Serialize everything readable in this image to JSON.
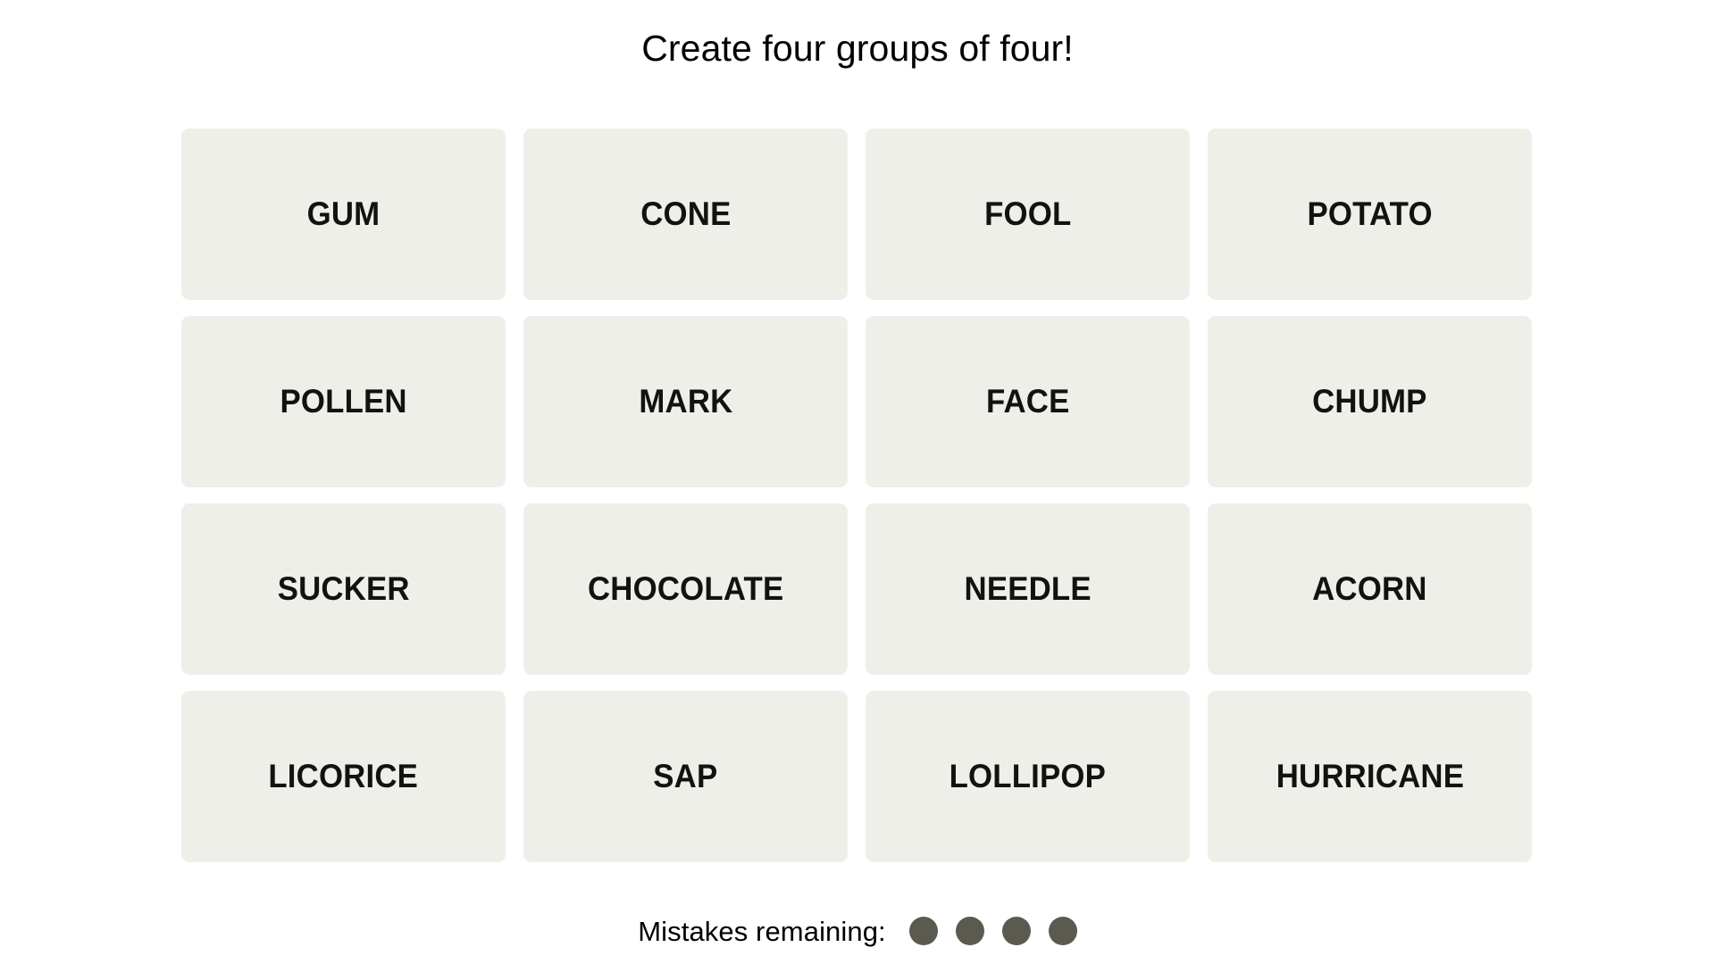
{
  "header": {
    "instruction": "Create four groups of four!"
  },
  "board": {
    "rows": [
      {
        "tiles": [
          {
            "word": "GUM"
          },
          {
            "word": "CONE"
          },
          {
            "word": "FOOL"
          },
          {
            "word": "POTATO"
          }
        ]
      },
      {
        "tiles": [
          {
            "word": "POLLEN"
          },
          {
            "word": "MARK"
          },
          {
            "word": "FACE"
          },
          {
            "word": "CHUMP"
          }
        ]
      },
      {
        "tiles": [
          {
            "word": "SUCKER"
          },
          {
            "word": "CHOCOLATE"
          },
          {
            "word": "NEEDLE"
          },
          {
            "word": "ACORN"
          }
        ]
      },
      {
        "tiles": [
          {
            "word": "LICORICE"
          },
          {
            "word": "SAP"
          },
          {
            "word": "LOLLIPOP"
          },
          {
            "word": "HURRICANE"
          }
        ]
      }
    ]
  },
  "footer": {
    "mistakes_label": "Mistakes remaining:",
    "mistakes_remaining": 4,
    "dots": [
      {
        "name": "mistake-dot-1"
      },
      {
        "name": "mistake-dot-2"
      },
      {
        "name": "mistake-dot-3"
      },
      {
        "name": "mistake-dot-4"
      }
    ]
  },
  "colors": {
    "page_background": "#FFFFFF",
    "tile_background": "#EFEFE9",
    "tile_text": "#121212",
    "dot_fill": "#5A5A50",
    "title_text": "#000000"
  }
}
